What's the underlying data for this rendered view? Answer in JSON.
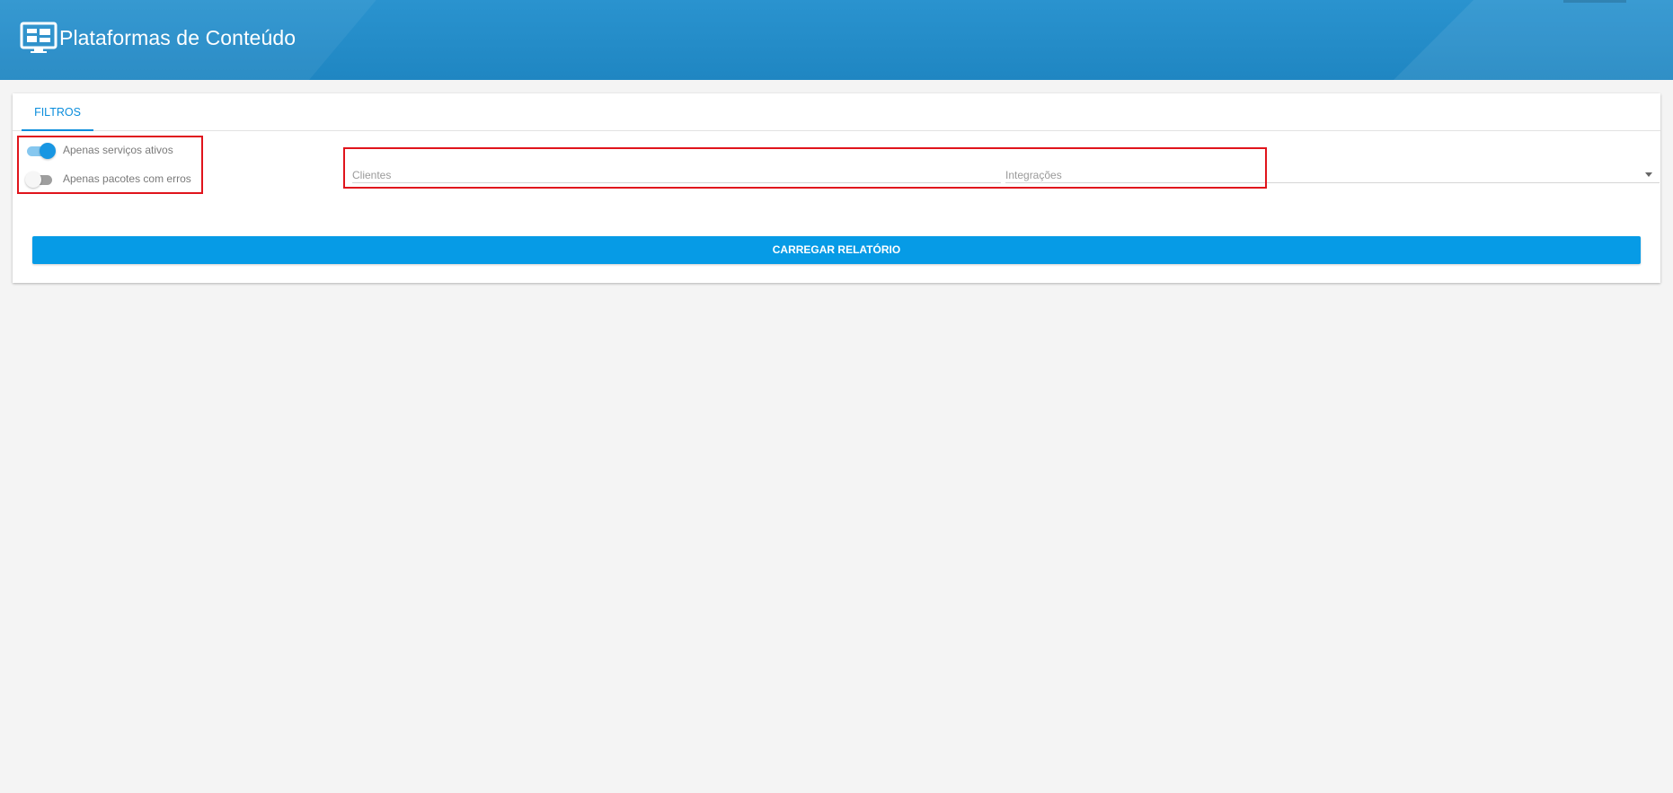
{
  "header": {
    "title": "Plataformas de Conteúdo",
    "icon": "dashboard-monitor-icon"
  },
  "tabs": [
    {
      "label": "FILTROS",
      "active": true
    }
  ],
  "filters": {
    "toggles": [
      {
        "label": "Apenas serviços ativos",
        "checked": true
      },
      {
        "label": "Apenas pacotes com erros",
        "checked": false
      }
    ],
    "clientes": {
      "placeholder": "Clientes"
    },
    "integracoes": {
      "placeholder": "Integrações"
    }
  },
  "actions": {
    "load_label": "CARREGAR RELATÓRIO"
  },
  "colors": {
    "header": "#2190cc",
    "accent": "#069be6",
    "highlight": "#e0141c"
  }
}
